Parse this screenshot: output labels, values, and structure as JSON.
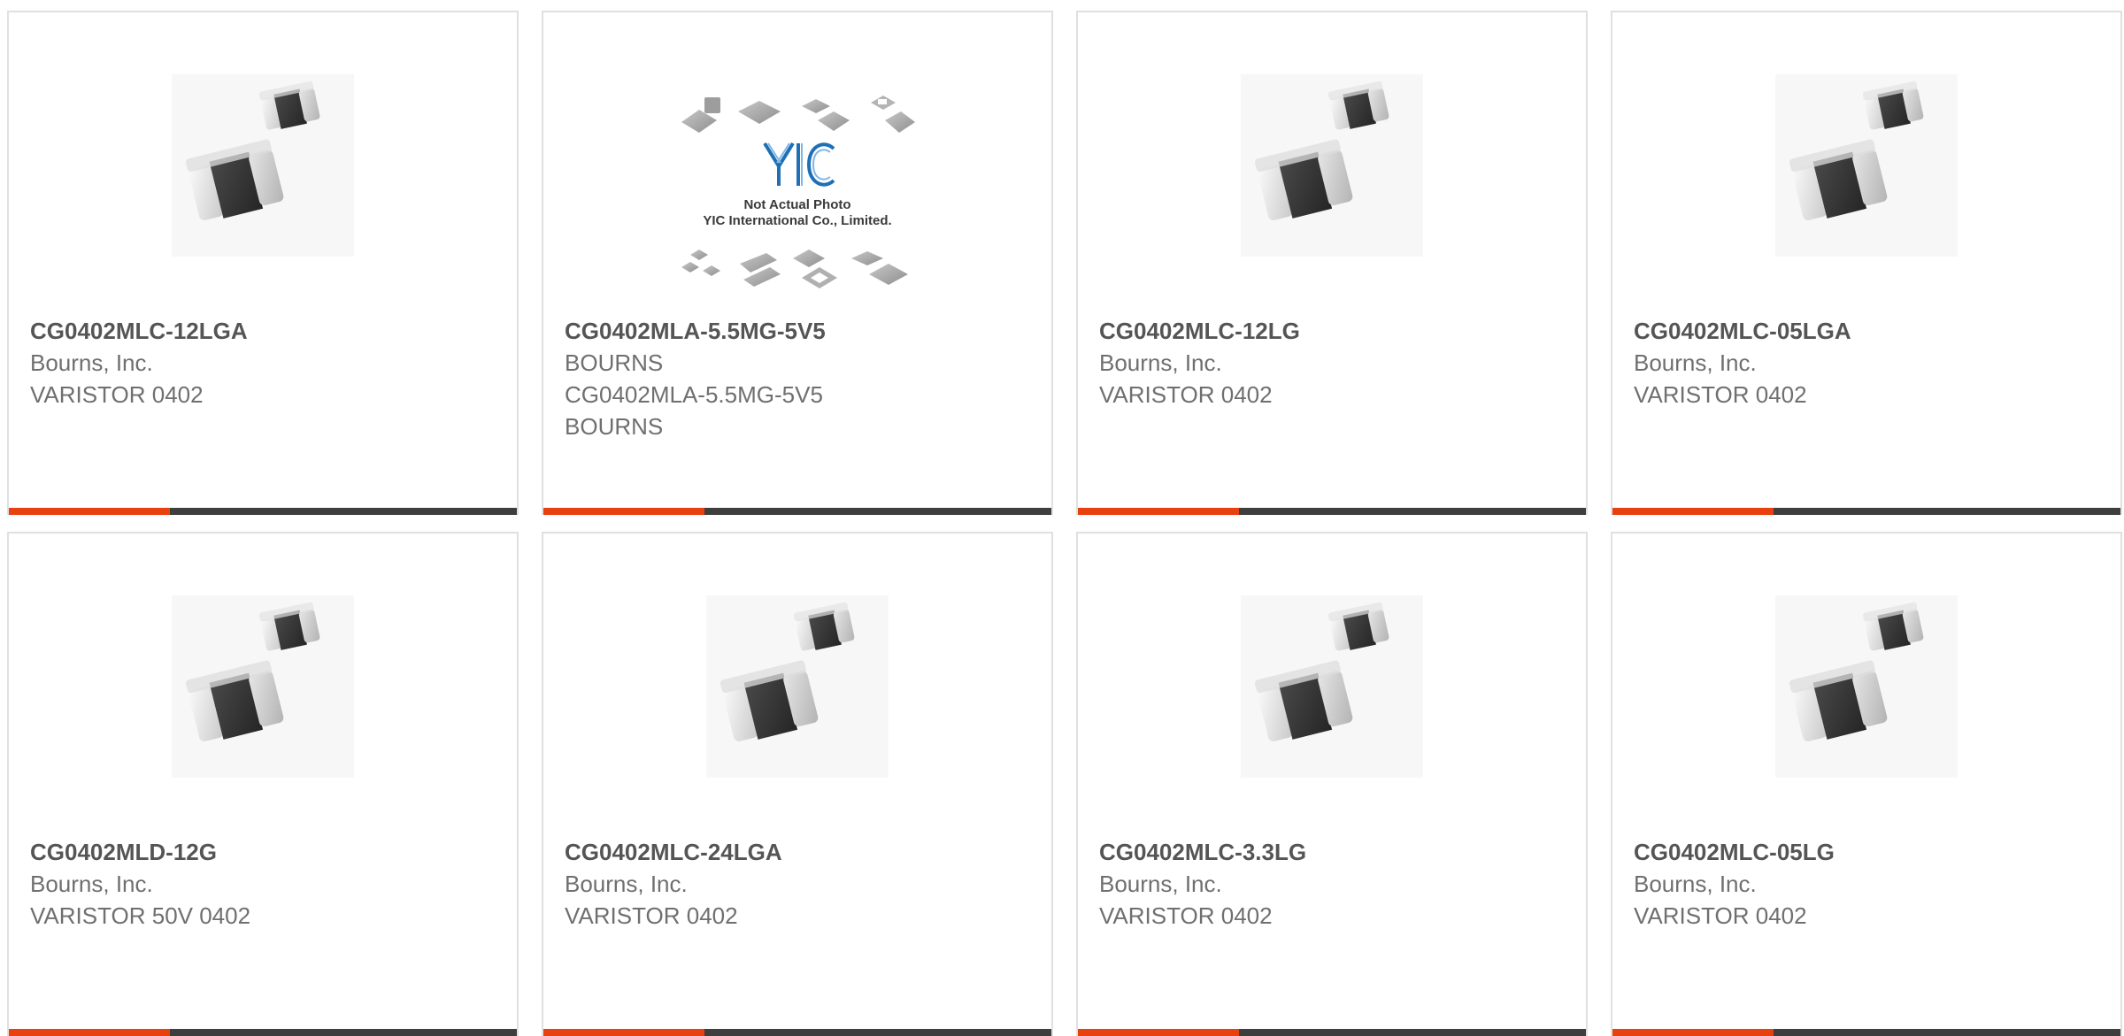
{
  "products": [
    {
      "part_number": "CG0402MLC-12LGA",
      "lines": [
        "Bourns, Inc.",
        "VARISTOR 0402"
      ],
      "image_icon": "varistor-chip-icon"
    },
    {
      "part_number": "CG0402MLA-5.5MG-5V5",
      "lines": [
        "BOURNS",
        "CG0402MLA-5.5MG-5V5",
        "BOURNS"
      ],
      "image_icon": "yic-placeholder-icon",
      "image_caption_1": "Not Actual Photo",
      "image_caption_2": "YIC International Co., Limited.",
      "logo_text": "YIC"
    },
    {
      "part_number": "CG0402MLC-12LG",
      "lines": [
        "Bourns, Inc.",
        "VARISTOR 0402"
      ],
      "image_icon": "varistor-chip-icon"
    },
    {
      "part_number": "CG0402MLC-05LGA",
      "lines": [
        "Bourns, Inc.",
        "VARISTOR 0402"
      ],
      "image_icon": "varistor-chip-icon"
    },
    {
      "part_number": "CG0402MLD-12G",
      "lines": [
        "Bourns, Inc.",
        "VARISTOR 50V 0402"
      ],
      "image_icon": "varistor-chip-icon"
    },
    {
      "part_number": "CG0402MLC-24LGA",
      "lines": [
        "Bourns, Inc.",
        "VARISTOR 0402"
      ],
      "image_icon": "varistor-chip-icon"
    },
    {
      "part_number": "CG0402MLC-3.3LG",
      "lines": [
        "Bourns, Inc.",
        "VARISTOR 0402"
      ],
      "image_icon": "varistor-chip-icon"
    },
    {
      "part_number": "CG0402MLC-05LG",
      "lines": [
        "Bourns, Inc.",
        "VARISTOR 0402"
      ],
      "image_icon": "varistor-chip-icon"
    }
  ],
  "colors": {
    "accent": "#e8410f",
    "bar": "#3e3e3e",
    "part_number": "#555555",
    "description": "#6f6f6f",
    "border": "#e0e0e0"
  }
}
